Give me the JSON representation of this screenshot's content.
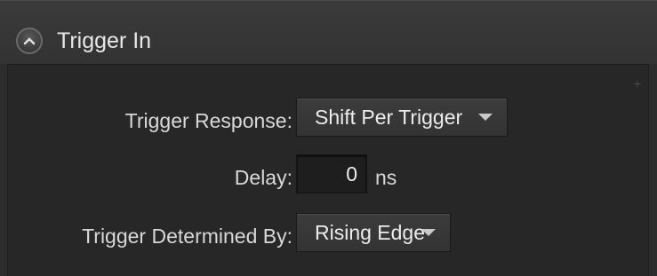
{
  "header": {
    "title": "Trigger In",
    "collapse_icon": "chevron-up-circle-icon"
  },
  "fields": {
    "trigger_response": {
      "label": "Trigger Response:",
      "value": "Shift Per Trigger"
    },
    "delay": {
      "label": "Delay:",
      "value": "0",
      "unit": "ns"
    },
    "trigger_determined_by": {
      "label": "Trigger Determined By:",
      "value": "Rising Edge"
    }
  },
  "colors": {
    "panel_bg": "#2d2d2d",
    "content_bg": "#272727",
    "text": "#d8d8d8"
  }
}
